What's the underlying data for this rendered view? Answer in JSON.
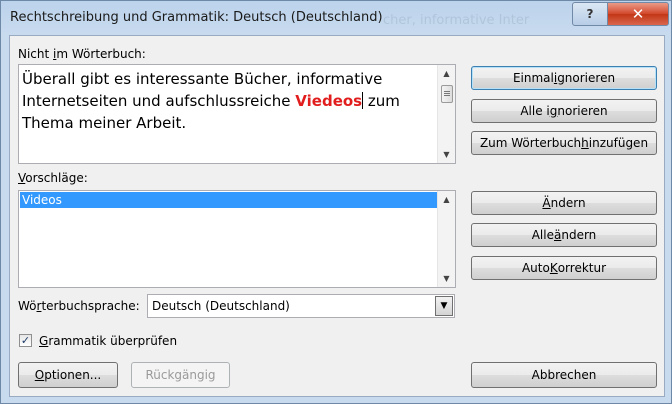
{
  "window": {
    "title": "Rechtschreibung und Grammatik: Deutsch (Deutschland)",
    "background_text": "cher, informative Inter",
    "help_label": "?",
    "close_label": "✕"
  },
  "not_in_dictionary": {
    "label_pre": "Nicht ",
    "label_ul": "i",
    "label_post": "m Wörterbuch:",
    "text_before": "Überall gibt es interessante  Bücher, informative Internetseiten und aufschlussreiche ",
    "error_word": "Viedeos",
    "text_after": " zum Thema meiner Arbeit.",
    "error_color": "#e21d1d"
  },
  "suggestions": {
    "label_ul": "V",
    "label_post": "orschläge:",
    "items": [
      "Videos"
    ],
    "selected_color": "#3399ff"
  },
  "buttons": {
    "ignore_once": {
      "pre": "Einmal ",
      "ul": "i",
      "post": "gnorieren"
    },
    "ignore_all": {
      "pre": "Alle i",
      "ul": "g",
      "post": "norieren"
    },
    "add_dictionary": {
      "pre": "Zum Wörterbuch ",
      "ul": "h",
      "post": "inzufügen"
    },
    "change": {
      "pre": "",
      "ul": "Ä",
      "post": "ndern"
    },
    "change_all": {
      "pre": "Alle ",
      "ul": "ä",
      "post": "ndern"
    },
    "autocorrect": {
      "pre": "Auto",
      "ul": "K",
      "post": "orrektur"
    },
    "options": {
      "pre": "",
      "ul": "O",
      "post": "ptionen..."
    },
    "undo": {
      "label": "Rückgängig"
    },
    "cancel": {
      "label": "Abbrechen"
    }
  },
  "language": {
    "label_pre": "Wö",
    "label_ul": "r",
    "label_post": "terbuchsprache:",
    "value": "Deutsch (Deutschland)"
  },
  "grammar_check": {
    "label_pre": "",
    "label_ul": "G",
    "label_post": "rammatik überprüfen",
    "checked": true,
    "check_mark": "✓"
  }
}
